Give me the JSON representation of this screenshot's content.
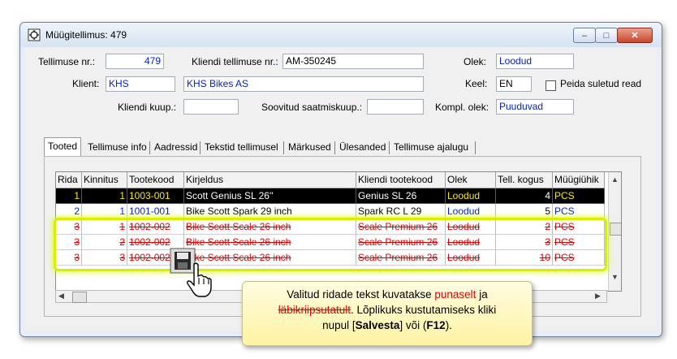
{
  "window": {
    "title": "Müügitellimus: 479",
    "minimize": "–",
    "maximize": "□",
    "close": "✕"
  },
  "form": {
    "order_no_label": "Tellimuse nr.:",
    "order_no": "479",
    "client_order_label": "Kliendi tellimuse nr.:",
    "client_order": "AM-350245",
    "status_label": "Olek:",
    "status": "Loodud",
    "client_label": "Klient:",
    "client_code": "KHS",
    "client_name": "KHS Bikes AS",
    "language_label": "Keel:",
    "language": "EN",
    "hide_closed_label": "Peida suletud read",
    "client_purchase_label": "Kliendi kuup.:",
    "client_purchase": "",
    "desired_shipping_label": "Soovitud saatmiskuup.:",
    "desired_shipping": "",
    "complete_status_label": "Kompl. olek:",
    "complete_status": "Puuduvad"
  },
  "tabs": [
    "Tooted",
    "Tellimuse info",
    "Aadressid",
    "Tekstid tellimusel",
    "Märkused",
    "Ülesanded",
    "Tellimuse ajalugu"
  ],
  "grid": {
    "columns": [
      "Rida",
      "Kinnitus",
      "Tootekood",
      "Kirjeldus",
      "Kliendi tootekood",
      "Olek",
      "Tell. kogus",
      "Müügiühik"
    ],
    "rows": [
      [
        "1",
        "1",
        "1003-001",
        "Scott Genius SL 26''",
        "Genius SL 26",
        "Loodud",
        "4",
        "PCS"
      ],
      [
        "2",
        "1",
        "1001-001",
        "Bike Scott Spark 29 inch",
        "Spark RC L 29",
        "Loodud",
        "5",
        "PCS"
      ],
      [
        "3",
        "1",
        "1002-002",
        "Bike Scott Scale 26 inch",
        "Scale Premium 26",
        "Loodud",
        "2",
        "PCS"
      ],
      [
        "3",
        "2",
        "1002-002",
        "Bike Scott Scale 26 inch",
        "Scale Premium 26",
        "Loodud",
        "3",
        "PCS"
      ],
      [
        "3",
        "3",
        "1002-002",
        "Bike Scott Scale 26 inch",
        "Scale Premium 26",
        "Loodud",
        "10",
        "PCS"
      ]
    ]
  },
  "callout": {
    "t1": "Valitud ridade tekst kuvatakse ",
    "t_red": "punaselt",
    "t2": " ja",
    "t_strike": "läbikriipsutatult",
    "t3": ".  Lõplikuks kustutamiseks kliki",
    "t4": "nupul [",
    "t_save": "Salvesta",
    "t5": "]  või  (",
    "t_key": "F12",
    "t6": ")."
  },
  "icons": [
    "app-icon",
    "save-icon",
    "hand-cursor-icon"
  ],
  "colors": {
    "highlight": "#d8f000",
    "deleted_text": "#e00000",
    "field_blue": "#0020d0",
    "selected_row_bg": "#000000",
    "selected_row_unit": "#ffe800"
  }
}
